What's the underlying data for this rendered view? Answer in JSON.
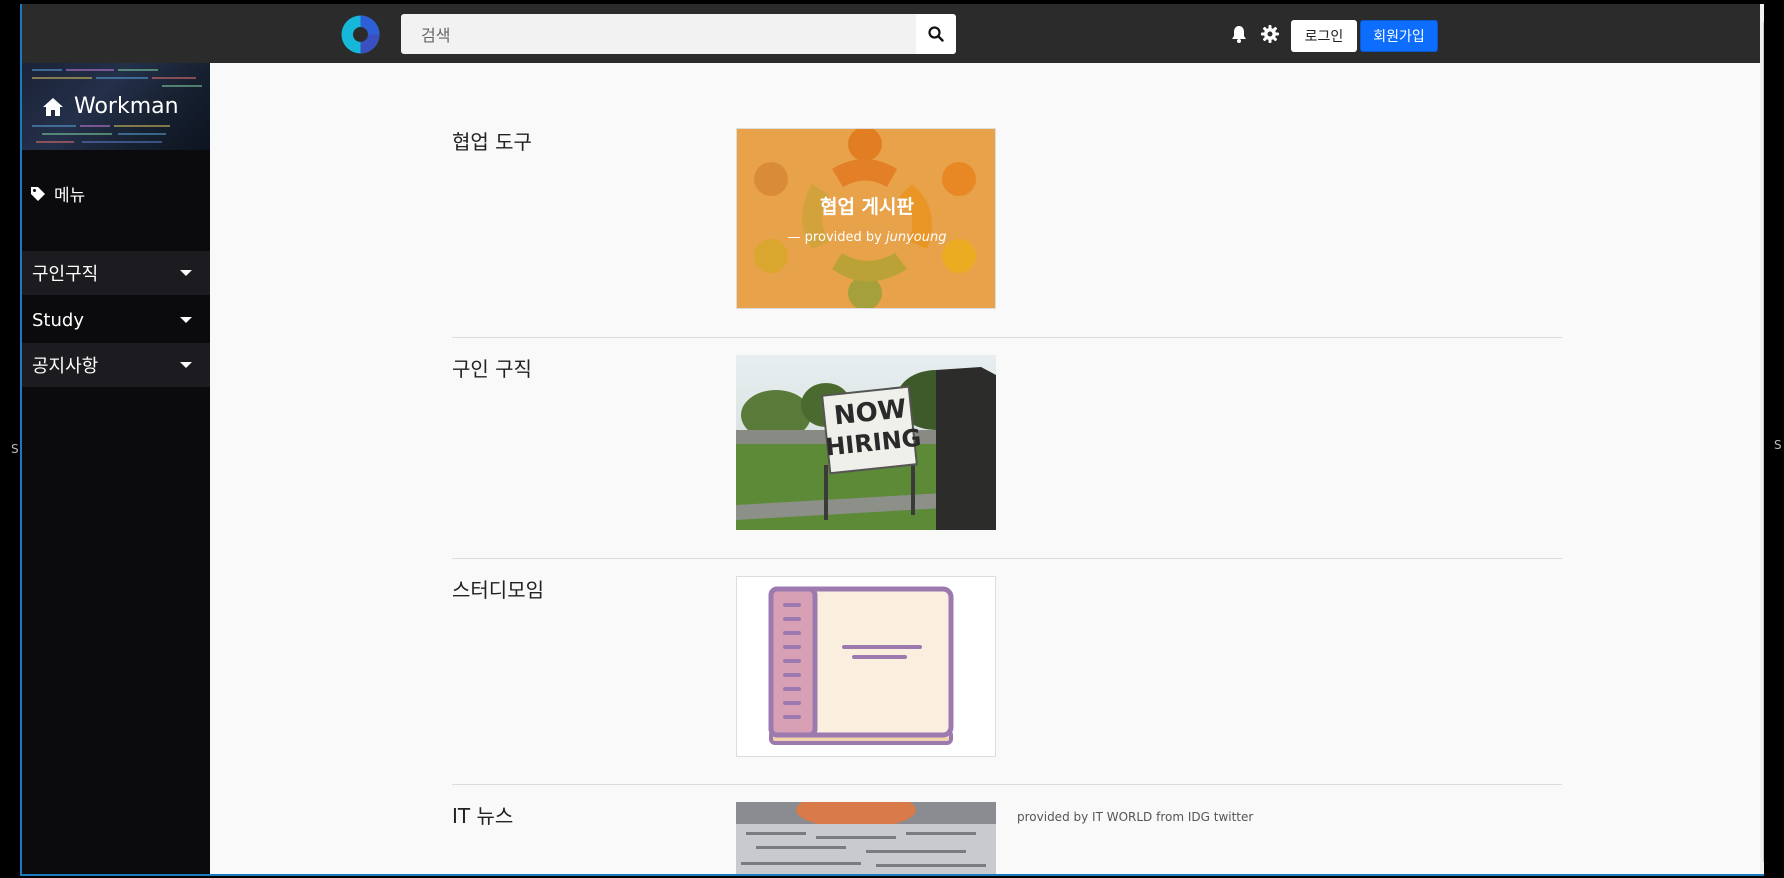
{
  "topbar": {
    "search_placeholder": "검색",
    "login_label": "로그인",
    "signup_label": "회원가입"
  },
  "sidebar": {
    "brand": "Workman",
    "menu_header": "메뉴",
    "items": [
      {
        "label": "구인구직"
      },
      {
        "label": "Study"
      },
      {
        "label": "공지사항"
      }
    ]
  },
  "sections": [
    {
      "title": "협업 도구",
      "card_title": "협업 게시판",
      "card_credit_prefix": "— provided by",
      "card_credit_author": "junyoung"
    },
    {
      "title": "구인 구직",
      "sign_line1": "NOW",
      "sign_line2": "HIRING"
    },
    {
      "title": "스터디모임"
    },
    {
      "title": "IT 뉴스",
      "caption": "provided by IT WORLD from IDG twitter"
    }
  ],
  "colors": {
    "topbar": "#2b2b2b",
    "sidebar": "#0b0b0d",
    "accent": "#0d6efd",
    "collab_card": "#e7a24a"
  },
  "icons": [
    "app-logo-icon",
    "search-icon",
    "bell-icon",
    "gear-icon",
    "home-icon",
    "tag-icon",
    "caret-down-icon"
  ]
}
